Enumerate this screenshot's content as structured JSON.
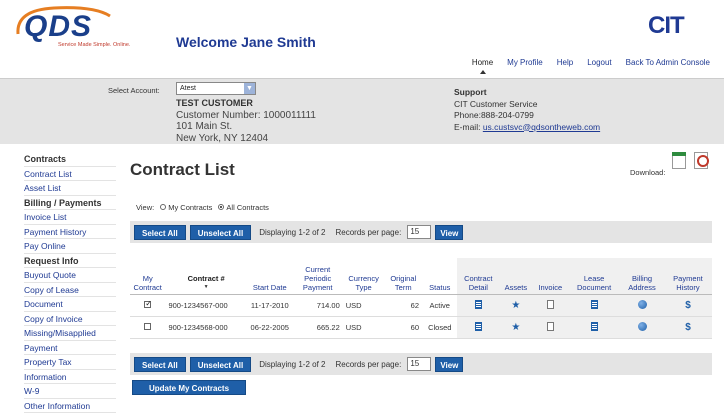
{
  "header": {
    "logo_text": "QDS",
    "logo_tagline": "Service Made Simple. Online.",
    "welcome": "Welcome Jane Smith",
    "brand_logo": "CIT",
    "nav": [
      "Home",
      "My Profile",
      "Help",
      "Logout",
      "Back To Admin Console"
    ]
  },
  "account": {
    "label": "Select Account:",
    "selected": "Atest",
    "customer_name": "TEST CUSTOMER",
    "customer_number": "Customer Number: 1000011111",
    "address1": "101 Main St.",
    "address2": "New York, NY 12404"
  },
  "support": {
    "title": "Support",
    "line1": "CIT Customer Service",
    "phone": "Phone:888-204-0799",
    "email_label": "E-mail:",
    "email": "us.custsvc@qdsontheweb.com"
  },
  "sidebar": [
    {
      "type": "head",
      "label": "Contracts"
    },
    {
      "type": "link",
      "label": "Contract List"
    },
    {
      "type": "link",
      "label": "Asset List"
    },
    {
      "type": "head",
      "label": "Billing / Payments"
    },
    {
      "type": "link",
      "label": "Invoice List"
    },
    {
      "type": "link",
      "label": "Payment History"
    },
    {
      "type": "link",
      "label": "Pay Online"
    },
    {
      "type": "head",
      "label": "Request Info"
    },
    {
      "type": "link",
      "label": "Buyout Quote"
    },
    {
      "type": "link",
      "label": "Copy of Lease"
    },
    {
      "type": "link",
      "label": "Document"
    },
    {
      "type": "link",
      "label": "Copy of Invoice"
    },
    {
      "type": "link",
      "label": "Missing/Misapplied"
    },
    {
      "type": "link",
      "label": "Payment"
    },
    {
      "type": "link",
      "label": "Property Tax"
    },
    {
      "type": "link",
      "label": "Information"
    },
    {
      "type": "link",
      "label": "W-9"
    },
    {
      "type": "link",
      "label": "Other Information"
    }
  ],
  "main": {
    "title": "Contract List",
    "download_label": "Download:",
    "view_label": "View:",
    "view_options": [
      "My Contracts",
      "All Contracts"
    ],
    "view_selected": "All Contracts",
    "select_all": "Select All",
    "unselect_all": "Unselect All",
    "displaying": "Displaying 1-2 of 2",
    "records_label": "Records per page:",
    "records_value": "15",
    "view_button": "View",
    "update_button": "Update My Contracts"
  },
  "table": {
    "headers": [
      "My Contract",
      "Contract #",
      "Start Date",
      "Current Periodic Payment",
      "Currency Type",
      "Original Term",
      "Status",
      "Contract Detail",
      "Assets",
      "Invoice",
      "Lease Document",
      "Billing Address",
      "Payment History"
    ],
    "rows": [
      {
        "checked": true,
        "contract": "900-1234567-000",
        "start": "11-17-2010",
        "payment": "714.00",
        "currency": "USD",
        "term": "62",
        "status": "Active"
      },
      {
        "checked": false,
        "contract": "900-1234568-000",
        "start": "06-22-2005",
        "payment": "665.22",
        "currency": "USD",
        "term": "60",
        "status": "Closed"
      }
    ]
  }
}
